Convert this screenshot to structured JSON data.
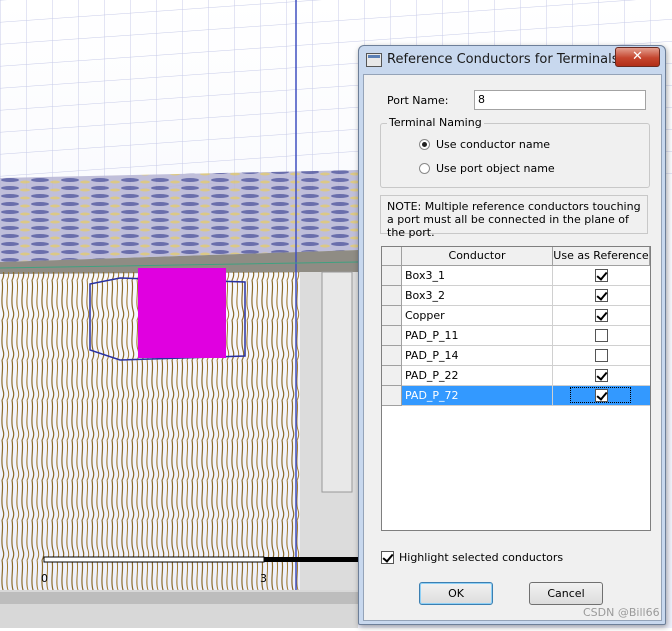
{
  "dialog": {
    "title": "Reference Conductors for Terminals",
    "close_glyph": "✕",
    "port_name_label": "Port Name:",
    "port_name_value": "8",
    "terminal_naming": {
      "legend": "Terminal Naming",
      "options": [
        {
          "label": "Use conductor name",
          "selected": true
        },
        {
          "label": "Use port object name",
          "selected": false
        }
      ]
    },
    "note": "NOTE: Multiple reference conductors touching a port must all be connected in the plane of the port.",
    "grid": {
      "columns": [
        "Conductor",
        "Use as Reference"
      ],
      "rows": [
        {
          "conductor": "Box3_1",
          "use_as_reference": true,
          "selected": false
        },
        {
          "conductor": "Box3_2",
          "use_as_reference": true,
          "selected": false
        },
        {
          "conductor": "Copper",
          "use_as_reference": true,
          "selected": false
        },
        {
          "conductor": "PAD_P_11",
          "use_as_reference": false,
          "selected": false
        },
        {
          "conductor": "PAD_P_14",
          "use_as_reference": false,
          "selected": false
        },
        {
          "conductor": "PAD_P_22",
          "use_as_reference": true,
          "selected": false
        },
        {
          "conductor": "PAD_P_72",
          "use_as_reference": true,
          "selected": true
        }
      ]
    },
    "highlight_label": "Highlight selected conductors",
    "highlight_checked": true,
    "ok_label": "OK",
    "cancel_label": "Cancel"
  },
  "viewport": {
    "ruler_labels": [
      "0",
      "3"
    ],
    "colors": {
      "background": "#ffffff",
      "grid": "#c7cbe8",
      "axis": "#4050c0",
      "copper": "#8a6a2a",
      "selected": "#e000e0"
    }
  },
  "watermark": "CSDN @Bill66",
  "colors": {
    "dialog_frame": "#c8d8ee",
    "client": "#f0f0f0",
    "selection": "#3399ff"
  }
}
